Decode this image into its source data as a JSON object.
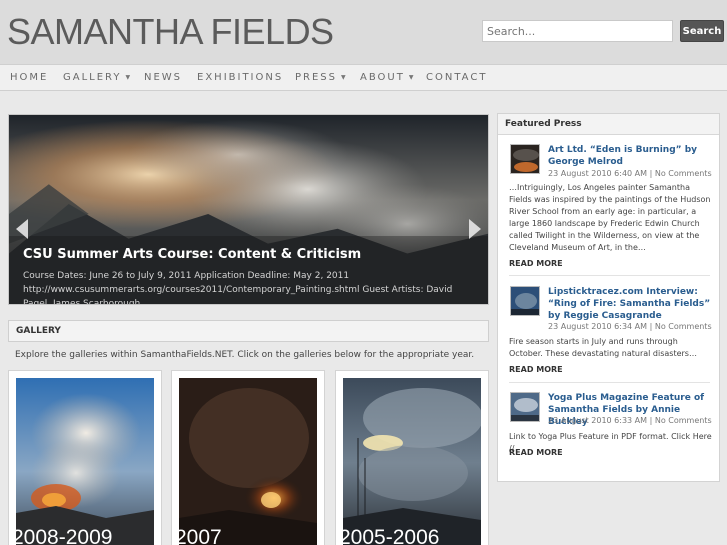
{
  "header": {
    "site_title": "SAMANTHA FIELDS",
    "search_placeholder": "Search...",
    "search_button": "Search"
  },
  "nav": {
    "items": [
      {
        "label": "HOME",
        "has_dropdown": false
      },
      {
        "label": "GALLERY",
        "has_dropdown": true
      },
      {
        "label": "NEWS",
        "has_dropdown": false
      },
      {
        "label": "EXHIBITIONS",
        "has_dropdown": false
      },
      {
        "label": "PRESS",
        "has_dropdown": true
      },
      {
        "label": "ABOUT",
        "has_dropdown": true
      },
      {
        "label": "CONTACT",
        "has_dropdown": false
      }
    ]
  },
  "slider": {
    "title": "CSU Summer Arts Course: Content & Criticism",
    "text": "Course Dates: June 26 to July 9, 2011 Application Deadline: May 2, 2011 http://www.csusummerarts.org/courses2011/Contemporary_Painting.shtml Guest Artists: David Pagel, James Scarborough",
    "prev_icon": "left-arrow-icon",
    "next_icon": "right-arrow-icon"
  },
  "gallery": {
    "title": "GALLERY",
    "intro": "Explore the galleries within SamanthaFields.NET. Click on the galleries below for the appropriate year.",
    "items": [
      {
        "label": "2008-2009"
      },
      {
        "label": "2007"
      },
      {
        "label": "2005-2006"
      }
    ]
  },
  "sidebar": {
    "title": "Featured Press",
    "items": [
      {
        "title": "Art Ltd. “Eden is Burning” by George Melrod",
        "date": "23 August 2010 6:40 AM",
        "comments": "No Comments",
        "excerpt": "…Intriguingly, Los Angeles painter Samantha Fields was inspired by the paintings of the Hudson River School from an early age: in particular, a large 1860 landscape by Frederic Edwin Church called Twilight in the Wilderness, on view at the Cleveland Museum of Art, in the…",
        "read_more": "READ MORE"
      },
      {
        "title": "Lipsticktracez.com Interview: “Ring of Fire: Samantha Fields” by Reggie Casagrande",
        "date": "23 August 2010 6:34 AM",
        "comments": "No Comments",
        "excerpt": "Fire season starts in July and runs through October. These devastating natural disasters…",
        "read_more": "READ MORE"
      },
      {
        "title": "Yoga Plus Magazine Feature of Samantha Fields by Annie Buckley",
        "date": "23 August 2010 6:33 AM",
        "comments": "No Comments",
        "excerpt": "Link to Yoga Plus Feature in PDF format. Click Here //",
        "read_more": "READ MORE"
      }
    ]
  },
  "colors": {
    "header_bg": "#dcdcdc",
    "link_blue": "#2a5d8f",
    "page_bg": "#e9e9e9"
  }
}
